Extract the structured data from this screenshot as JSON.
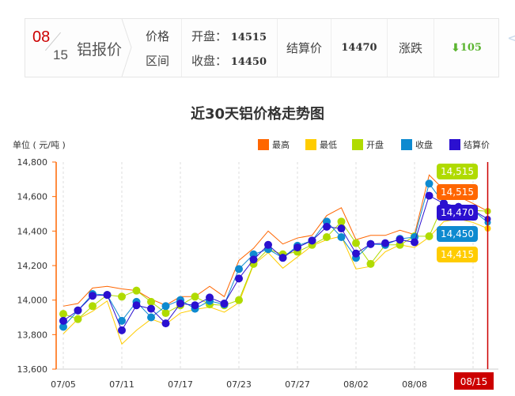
{
  "header": {
    "month": "08",
    "day": "15",
    "title": "铝报价",
    "range_label_1": "价格",
    "range_label_2": "区间",
    "open_label": "开盘：",
    "open_value": "14515",
    "close_label": "收盘：",
    "close_value": "14450",
    "settle_label": "结算价",
    "settle_value": "14470",
    "change_label": "涨跌",
    "change_value": "105",
    "change_direction": "down",
    "change_color": "#5cb531"
  },
  "nav": {
    "next_icon": "chevron-left-icon"
  },
  "chart_data": {
    "type": "line",
    "title": "近30天铝价格走势图",
    "ylabel": "单位 ( 元/吨 )",
    "ylim": [
      13600,
      14800
    ],
    "yticks": [
      "14,800",
      "14,600",
      "14,400",
      "14,200",
      "14,000",
      "13,800",
      "13,600"
    ],
    "xtick_labels": [
      "07/05",
      "07/11",
      "07/17",
      "07/23",
      "07/27",
      "08/02",
      "08/08"
    ],
    "highlight_label": "08/15",
    "legend_position": "top-right",
    "grid": "vertical-dashed",
    "series": [
      {
        "name": "最高",
        "color": "#ff6600",
        "markers": false,
        "values": [
          13965,
          13980,
          14070,
          14080,
          14065,
          14055,
          14005,
          13970,
          14020,
          14020,
          14080,
          14020,
          14230,
          14300,
          14400,
          14325,
          14360,
          14375,
          14490,
          14535,
          14350,
          14375,
          14375,
          14405,
          14380,
          14725,
          14640,
          14600,
          14560,
          14515
        ]
      },
      {
        "name": "最低",
        "color": "#ffcc00",
        "markers": false,
        "values": [
          13805,
          13890,
          13935,
          13995,
          13745,
          13825,
          13890,
          13860,
          13925,
          13945,
          13960,
          13930,
          13985,
          14205,
          14275,
          14185,
          14250,
          14315,
          14350,
          14370,
          14180,
          14195,
          14280,
          14320,
          14305,
          14365,
          14455,
          14470,
          14450,
          14415
        ]
      },
      {
        "name": "开盘",
        "color": "#b0db00",
        "markers": true,
        "values": [
          13920,
          13890,
          13965,
          14030,
          14020,
          14055,
          13990,
          13925,
          13970,
          14020,
          13975,
          13970,
          14000,
          14210,
          14295,
          14265,
          14280,
          14320,
          14365,
          14455,
          14330,
          14210,
          14320,
          14320,
          14370,
          14370,
          14560,
          14530,
          14520,
          14515
        ]
      },
      {
        "name": "收盘",
        "color": "#0e8ad0",
        "markers": true,
        "values": [
          13845,
          13940,
          14035,
          14030,
          13880,
          13990,
          13900,
          13965,
          14000,
          13950,
          13995,
          13975,
          14180,
          14265,
          14295,
          14245,
          14315,
          14345,
          14455,
          14365,
          14245,
          14325,
          14320,
          14355,
          14365,
          14675,
          14560,
          14540,
          14520,
          14450
        ]
      },
      {
        "name": "结算价",
        "color": "#2b10d0",
        "markers": true,
        "values": [
          13880,
          13940,
          14025,
          14030,
          13825,
          13970,
          13950,
          13865,
          13980,
          13970,
          14015,
          13980,
          14125,
          14235,
          14320,
          14245,
          14305,
          14345,
          14425,
          14415,
          14270,
          14325,
          14330,
          14350,
          14335,
          14605,
          14560,
          14540,
          14520,
          14470
        ]
      }
    ],
    "tooltip": [
      {
        "series": "开盘",
        "value": "14,515"
      },
      {
        "series": "最高",
        "value": "14,515"
      },
      {
        "series": "结算价",
        "value": "14,470"
      },
      {
        "series": "收盘",
        "value": "14,450"
      },
      {
        "series": "最低",
        "value": "14,415"
      }
    ]
  }
}
